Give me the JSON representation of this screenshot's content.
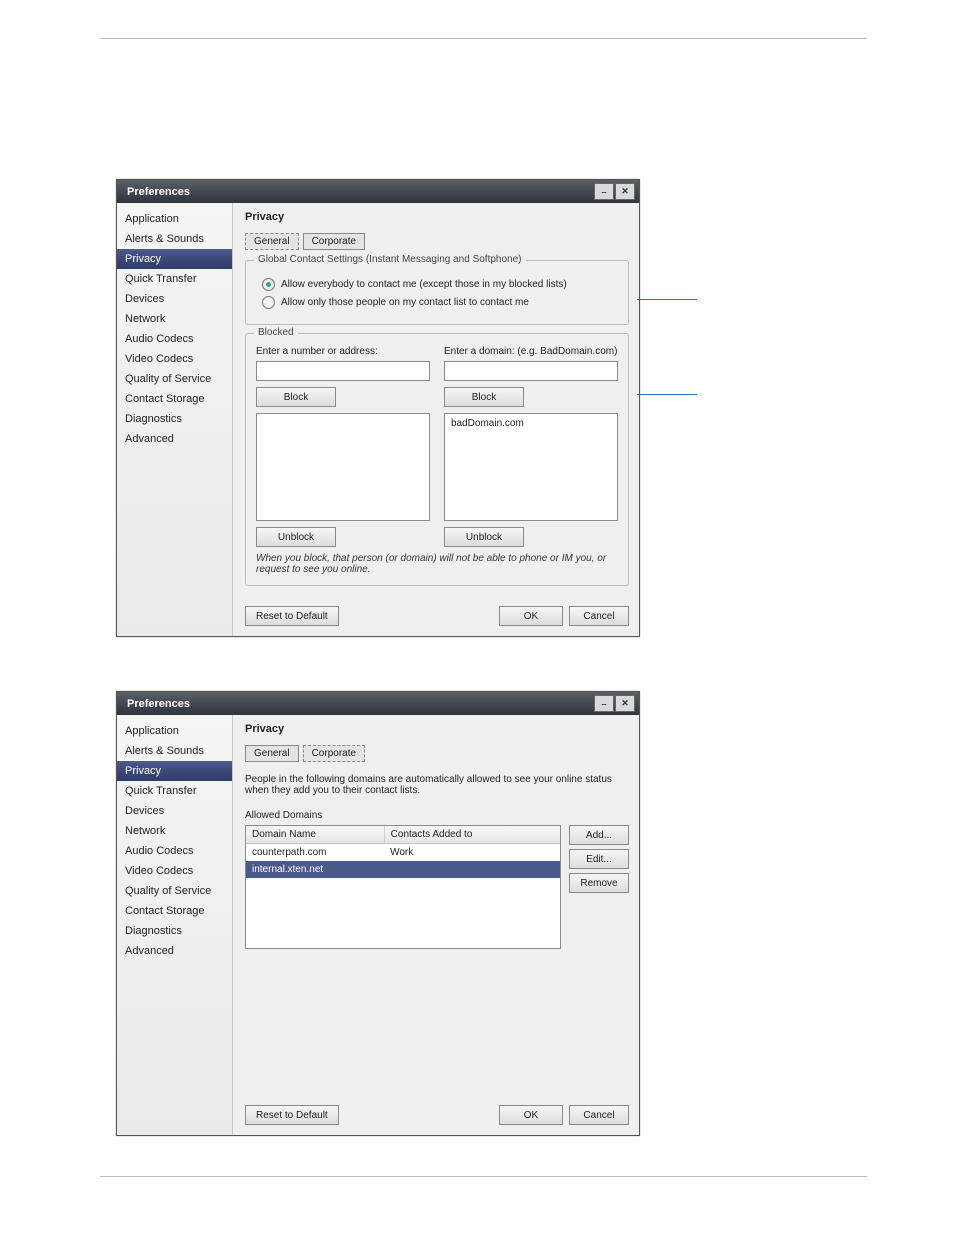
{
  "win_title": "Preferences",
  "sidebar": {
    "items": [
      "Application",
      "Alerts & Sounds",
      "Privacy",
      "Quick Transfer",
      "Devices",
      "Network",
      "Audio Codecs",
      "Video Codecs",
      "Quality of Service",
      "Contact Storage",
      "Diagnostics",
      "Advanced"
    ],
    "selected": "Privacy"
  },
  "content_title": "Privacy",
  "tabs": {
    "general": "General",
    "corporate": "Corporate"
  },
  "general": {
    "group1_legend": "Global Contact Settings (Instant Messaging and Softphone)",
    "radio1": "Allow everybody to contact me (except those in my blocked lists)",
    "radio2": "Allow only those people on my contact list to contact me",
    "blocked_legend": "Blocked",
    "left_label": "Enter a number or address:",
    "right_label": "Enter a domain: (e.g. BadDomain.com)",
    "block_btn": "Block",
    "unblock_btn": "Unblock",
    "right_list_item": "badDomain.com",
    "note": "When you block, that person (or domain) will not be able to phone or IM you, or request to see you online."
  },
  "corporate": {
    "desc": "People in the following domains are automatically allowed to see your online status when they add you to their contact lists.",
    "sub_h": "Allowed Domains",
    "col1": "Domain Name",
    "col2": "Contacts Added to",
    "rows": [
      {
        "c1": "counterpath.com",
        "c2": "Work"
      },
      {
        "c1": "internal.xten.net",
        "c2": ""
      }
    ],
    "add": "Add...",
    "edit": "Edit...",
    "remove": "Remove"
  },
  "footer": {
    "reset": "Reset to Default",
    "ok": "OK",
    "cancel": "Cancel"
  }
}
